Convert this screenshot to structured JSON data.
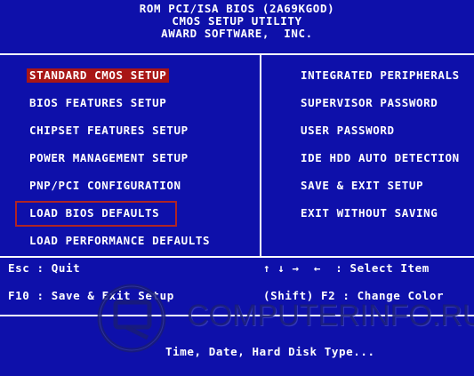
{
  "header": {
    "line1": "ROM PCI/ISA BIOS (2A69KGOD)",
    "line2": "CMOS SETUP UTILITY",
    "line3": "AWARD SOFTWARE,  INC."
  },
  "left_menu": [
    "STANDARD CMOS SETUP",
    "BIOS FEATURES SETUP",
    "CHIPSET FEATURES SETUP",
    "POWER MANAGEMENT SETUP",
    "PNP/PCI CONFIGURATION",
    "LOAD BIOS DEFAULTS",
    "LOAD PERFORMANCE DEFAULTS"
  ],
  "right_menu": [
    "INTEGRATED PERIPHERALS",
    "SUPERVISOR PASSWORD",
    "USER PASSWORD",
    "IDE HDD AUTO DETECTION",
    "SAVE & EXIT SETUP",
    "EXIT WITHOUT SAVING"
  ],
  "footer": {
    "esc": "Esc : Quit",
    "f10": "F10 : Save & Exit Setup",
    "select": "↑ ↓ →  ←  : Select Item",
    "shift_f2": "(Shift) F2 : Change Color",
    "status": "Time, Date, Hard Disk Type..."
  },
  "watermark": {
    "text": "COMPUTERINFO.RU",
    "logo_icon": "computer-monitor-logo-icon"
  },
  "colors": {
    "background": "#0e10aa",
    "text": "#ffffff",
    "selection": "#a81616",
    "highlight_border": "#b02424"
  }
}
